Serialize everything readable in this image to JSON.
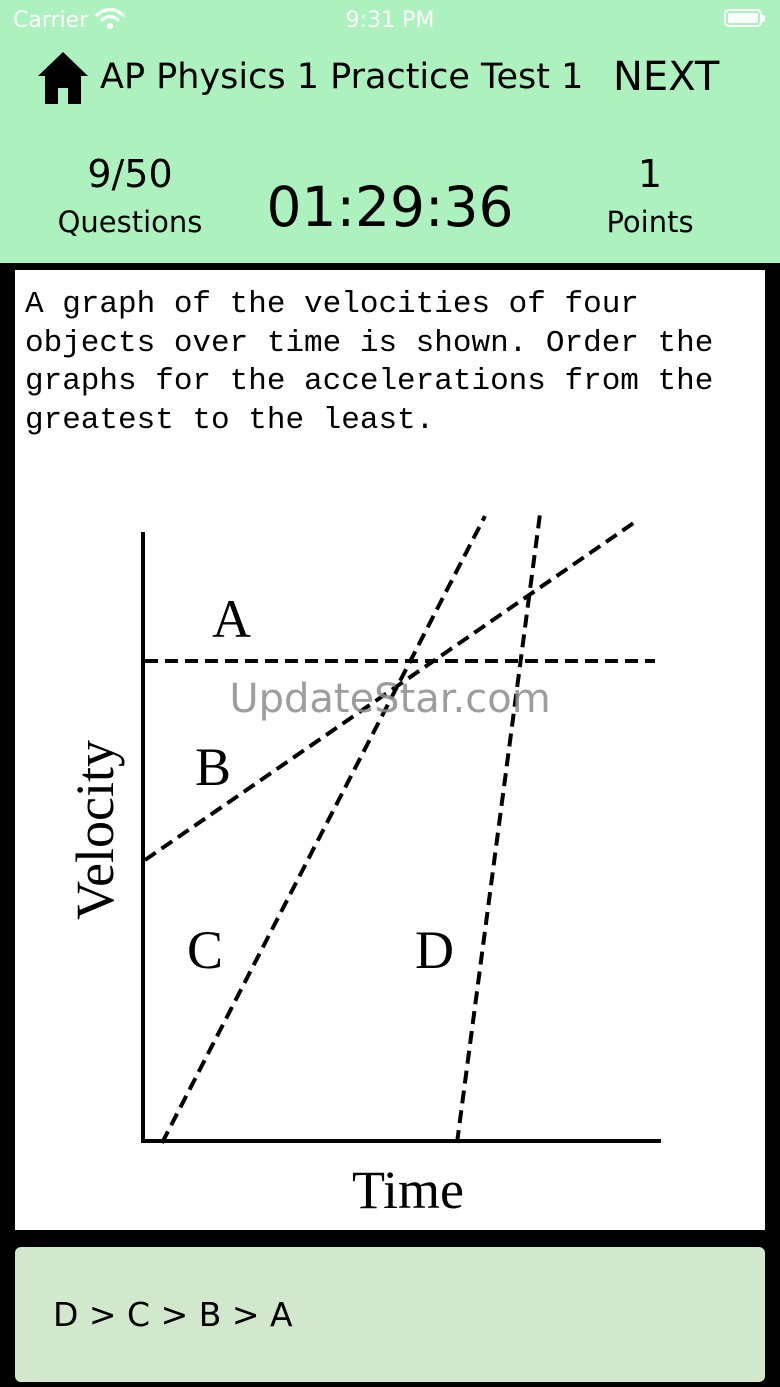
{
  "status_bar": {
    "carrier": "Carrier",
    "time": "9:31 PM"
  },
  "header": {
    "title": "AP Physics 1 Practice Test 1",
    "next_label": "NEXT",
    "question_count": "9/50",
    "questions_label": "Questions",
    "timer": "01:29:36",
    "points_value": "1",
    "points_label": "Points"
  },
  "question": {
    "text": "A graph of the velocities of four objects over time is shown. Order the graphs for the accelerations from the greatest to the least."
  },
  "figure": {
    "x_axis_label": "Time",
    "y_axis_label": "Velocity",
    "line_labels": [
      "A",
      "B",
      "C",
      "D"
    ],
    "watermark": "UpdateStar.com"
  },
  "answer": {
    "text": "D > C > B > A"
  },
  "colors": {
    "header_bg": "#adf2be",
    "answer_bg": "#d2e8cc"
  }
}
